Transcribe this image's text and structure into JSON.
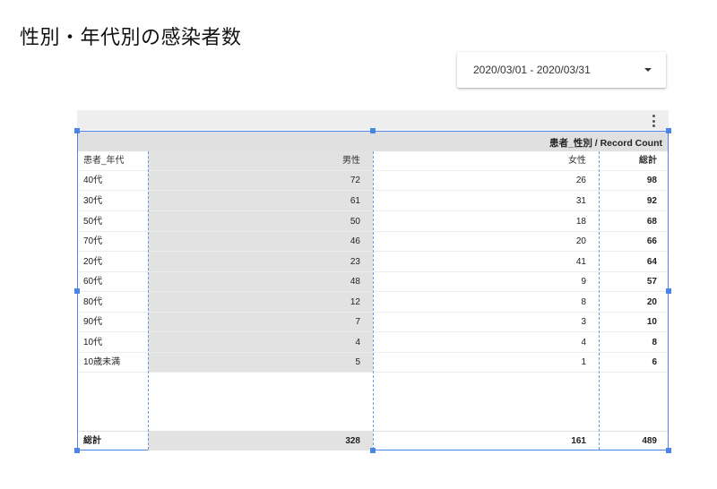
{
  "page": {
    "title": "性別・年代別の感染者数"
  },
  "date_filter": {
    "value": "2020/03/01 - 2020/03/31"
  },
  "table": {
    "pivot_header": "患者_性別 / Record Count",
    "columns": {
      "age": "患者_年代",
      "male": "男性",
      "female": "女性",
      "total": "総計"
    },
    "rows": [
      {
        "age": "40代",
        "male": "72",
        "female": "26",
        "total": "98"
      },
      {
        "age": "30代",
        "male": "61",
        "female": "31",
        "total": "92"
      },
      {
        "age": "50代",
        "male": "50",
        "female": "18",
        "total": "68"
      },
      {
        "age": "70代",
        "male": "46",
        "female": "20",
        "total": "66"
      },
      {
        "age": "20代",
        "male": "23",
        "female": "41",
        "total": "64"
      },
      {
        "age": "60代",
        "male": "48",
        "female": "9",
        "total": "57"
      },
      {
        "age": "80代",
        "male": "12",
        "female": "8",
        "total": "20"
      },
      {
        "age": "90代",
        "male": "7",
        "female": "3",
        "total": "10"
      },
      {
        "age": "10代",
        "male": "4",
        "female": "4",
        "total": "8"
      },
      {
        "age": "10歳未満",
        "male": "5",
        "female": "1",
        "total": "6"
      }
    ],
    "grand_total": {
      "label": "総計",
      "male": "328",
      "female": "161",
      "total": "489"
    }
  }
}
